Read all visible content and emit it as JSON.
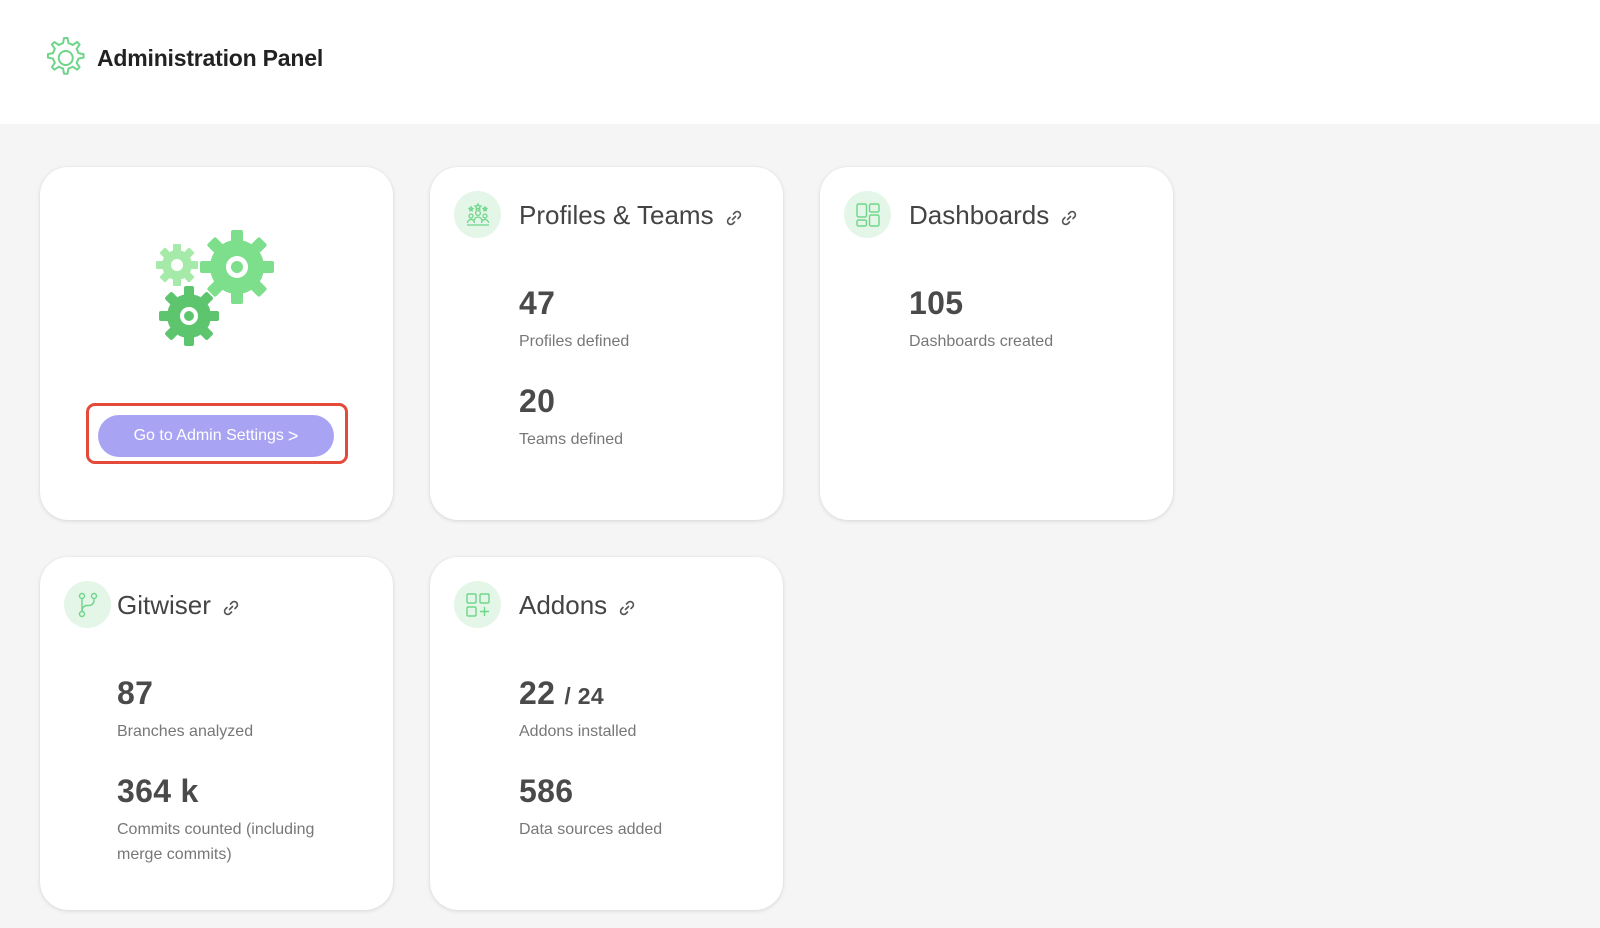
{
  "header": {
    "title": "Administration Panel",
    "icon": "gear-icon"
  },
  "admin_card": {
    "button_label": "Go to Admin Settings",
    "button_chevron": ">",
    "illustration": "gears-illustration"
  },
  "profiles_card": {
    "title": "Profiles & Teams",
    "icon": "team-icon",
    "stats": [
      {
        "value": "47",
        "label": "Profiles defined"
      },
      {
        "value": "20",
        "label": "Teams defined"
      }
    ]
  },
  "dashboards_card": {
    "title": "Dashboards",
    "icon": "dashboard-layout-icon",
    "stats": [
      {
        "value": "105",
        "label": "Dashboards created"
      }
    ]
  },
  "gitwiser_card": {
    "title": "Gitwiser",
    "icon": "git-branch-icon",
    "stats": [
      {
        "value": "87",
        "label": "Branches analyzed"
      },
      {
        "value": "364 k",
        "label": "Commits counted (including merge commits)"
      }
    ]
  },
  "addons_card": {
    "title": "Addons",
    "icon": "addons-grid-icon",
    "stats": [
      {
        "value": "22",
        "value_suffix": "/ 24",
        "label": "Addons installed"
      },
      {
        "value": "586",
        "label": "Data sources added"
      }
    ]
  },
  "colors": {
    "accent_green": "#6fd58a",
    "button_purple": "#a9a3f3",
    "highlight_red": "#e34a3a",
    "icon_circle_bg": "#e3f6e7"
  }
}
